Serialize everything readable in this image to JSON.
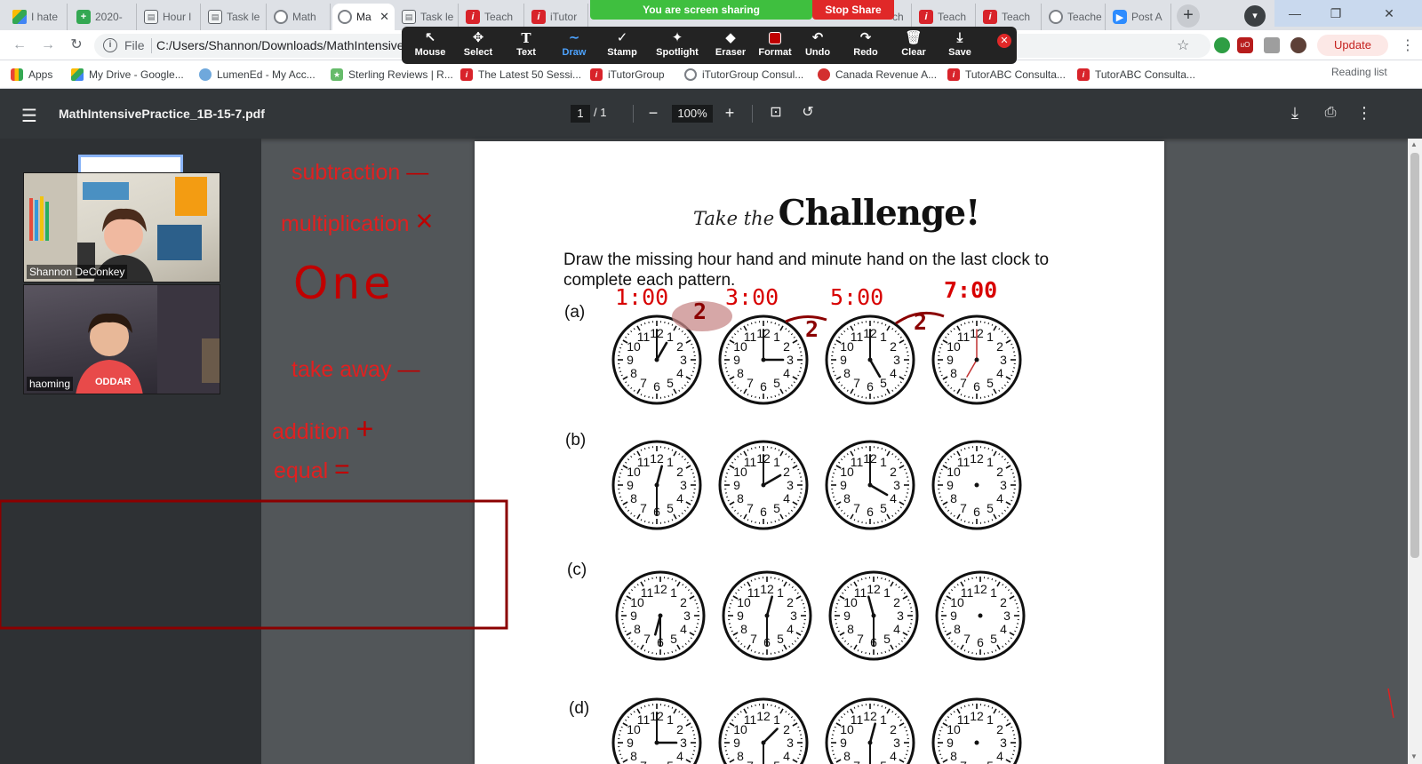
{
  "browser": {
    "tabs": [
      {
        "label": "I hate",
        "icon": "gdrive-icon"
      },
      {
        "label": "2020-",
        "icon": "sheets-icon"
      },
      {
        "label": "Hour l",
        "icon": "doc-icon"
      },
      {
        "label": "Task le",
        "icon": "doc-icon"
      },
      {
        "label": "Math",
        "icon": "globe-icon"
      },
      {
        "label": "Ma",
        "icon": "globe-icon",
        "active": true
      },
      {
        "label": "Task le",
        "icon": "doc-icon"
      },
      {
        "label": "Teach",
        "icon": "itutor-icon"
      },
      {
        "label": "iTutor",
        "icon": "itutor-icon"
      },
      {
        "label": "ch",
        "icon": "itutor-icon"
      },
      {
        "label": "Teach",
        "icon": "itutor-icon"
      },
      {
        "label": "Teach",
        "icon": "itutor-icon"
      },
      {
        "label": "Teache",
        "icon": "globe-icon"
      },
      {
        "label": "Post A",
        "icon": "zoom-icon"
      }
    ],
    "new_tab": "+",
    "address": {
      "scheme_label": "File",
      "url": "C:/Users/Shannon/Downloads/MathIntensive"
    },
    "update_label": "Update",
    "bookmarks": [
      {
        "label": "Apps"
      },
      {
        "label": "My Drive - Google..."
      },
      {
        "label": "LumenEd - My Acc..."
      },
      {
        "label": "Sterling Reviews | R..."
      },
      {
        "label": "The Latest 50 Sessi..."
      },
      {
        "label": "iTutorGroup"
      },
      {
        "label": "iTutorGroup Consul..."
      },
      {
        "label": "Canada Revenue A..."
      },
      {
        "label": "TutorABC Consulta..."
      },
      {
        "label": "TutorABC Consulta..."
      }
    ],
    "reading_list": "Reading list"
  },
  "zoom": {
    "share_status": "You are screen sharing",
    "stop_share": "Stop Share",
    "tools": [
      "Mouse",
      "Select",
      "Text",
      "Draw",
      "Stamp",
      "Spotlight",
      "Eraser",
      "Format",
      "Undo",
      "Redo",
      "Clear",
      "Save"
    ],
    "active_tool": "Draw",
    "participants": [
      {
        "name": "Shannon DeConkey"
      },
      {
        "name": "haoming"
      }
    ]
  },
  "pdf": {
    "title": "MathIntensivePractice_1B-15-7.pdf",
    "page_current": "1",
    "page_total": "/ 1",
    "zoom": "100%",
    "heading_small": "Take the",
    "heading_big": "Challenge!",
    "instructions": "Draw the missing hour hand and minute hand on the last clock to complete each pattern.",
    "rows": [
      {
        "label": "(a)",
        "clocks": [
          {
            "h": 1,
            "m": 0
          },
          {
            "h": 3,
            "m": 0
          },
          {
            "h": 5,
            "m": 0
          },
          {
            "h": 7,
            "m": 0,
            "drawn": true
          }
        ]
      },
      {
        "label": "(b)",
        "clocks": [
          {
            "h": 12,
            "m": 30
          },
          {
            "h": 2,
            "m": 0
          },
          {
            "h": 4,
            "m": 0
          },
          {
            "blank": true
          }
        ]
      },
      {
        "label": "(c)",
        "clocks": [
          {
            "h": 6,
            "m": 30
          },
          {
            "h": 12,
            "m": 30
          },
          {
            "h": 11,
            "m": 30
          },
          {
            "blank": true
          }
        ]
      },
      {
        "label": "(d)",
        "clocks": [
          {
            "h": 3,
            "m": 0
          },
          {
            "h": 1,
            "m": 30
          },
          {
            "h": 12,
            "m": 30
          },
          {
            "blank": true
          }
        ]
      }
    ]
  },
  "annotations": {
    "words": [
      {
        "text": "subtraction",
        "sym": "—"
      },
      {
        "text": "multiplication",
        "sym": "×"
      },
      {
        "text": "One",
        "sym": ""
      },
      {
        "text": "take away",
        "sym": "—"
      },
      {
        "text": "addition",
        "sym": "+"
      },
      {
        "text": "equal",
        "sym": "="
      }
    ],
    "times": [
      "1:00",
      "3:00",
      "5:00",
      "7:00"
    ],
    "gaps": [
      "2",
      "2",
      "2"
    ]
  },
  "colors": {
    "ink_red": "#e02020",
    "dark_ink": "#8b0000",
    "share_green": "#3fbf3f",
    "pdf_bar": "#323639",
    "pdf_bg": "#525659"
  }
}
